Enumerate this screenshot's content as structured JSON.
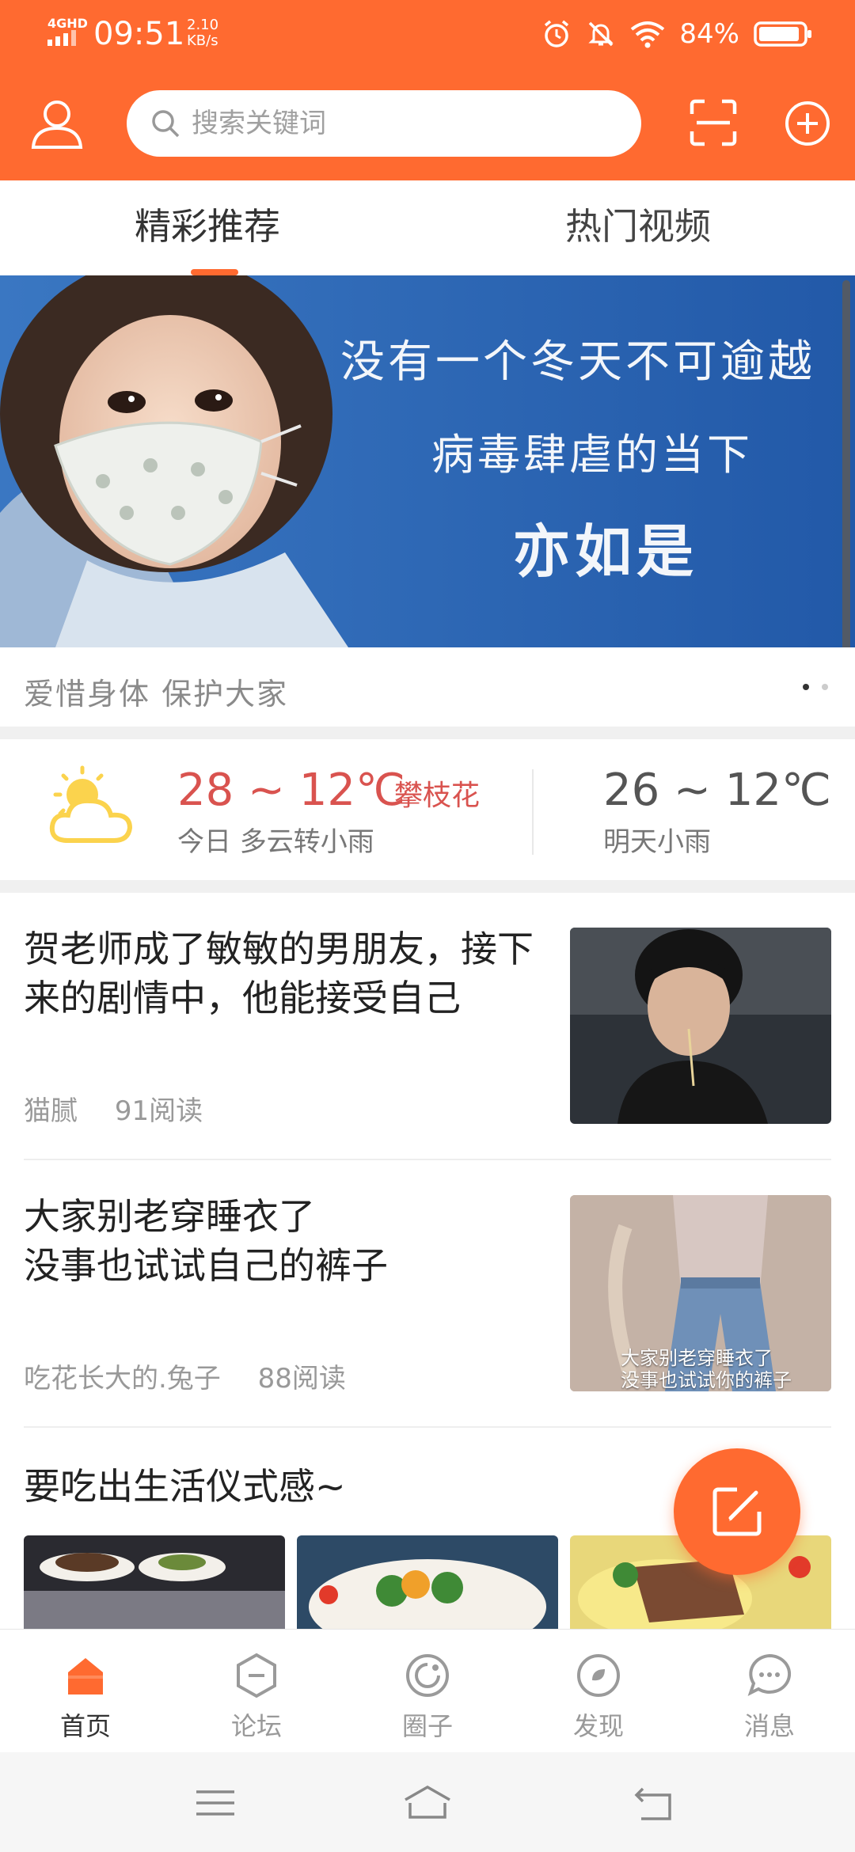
{
  "status_bar": {
    "network": "4GHD",
    "time": "09:51",
    "speed_value": "2.10",
    "speed_unit": "KB/s",
    "battery": "84%"
  },
  "header": {
    "search_placeholder": "搜索关键词",
    "user_icon": "user-icon",
    "scan_icon": "scan-icon",
    "add_icon": "add-circle-icon"
  },
  "tabs": [
    {
      "label": "精彩推荐",
      "active": true
    },
    {
      "label": "热门视频",
      "active": false
    }
  ],
  "banner": {
    "lines": [
      "没有一个冬天不可逾越",
      "病毒肆虐的当下",
      "亦如是"
    ],
    "caption": "爱惜身体  保护大家",
    "dots_total": 2,
    "dots_active_index": 0
  },
  "weather": {
    "today_temp": "28 ~ 12℃",
    "city": "攀枝花",
    "today_desc": "今日 多云转小雨",
    "tomorrow_temp": "26 ~ 12℃",
    "tomorrow_desc": "明天小雨",
    "icon": "partly-cloudy-icon"
  },
  "articles": [
    {
      "title": "贺老师成了敏敏的男朋友，接下来的剧情中，他能接受自己",
      "author": "猫腻",
      "reads": "91阅读"
    },
    {
      "title_line1": "大家别老穿睡衣了",
      "title_line2": "没事也试试自己的裤子",
      "author": "吃花长大的.兔子",
      "reads": "88阅读",
      "image_caption_line1": "大家别老穿睡衣了",
      "image_caption_line2": "没事也试试你的裤子"
    },
    {
      "title": "要吃出生活仪式感~"
    }
  ],
  "bottom_nav": [
    {
      "label": "首页",
      "icon": "home-icon",
      "active": true
    },
    {
      "label": "论坛",
      "icon": "forum-icon",
      "active": false
    },
    {
      "label": "圈子",
      "icon": "circle-icon",
      "active": false
    },
    {
      "label": "发现",
      "icon": "discover-icon",
      "active": false
    },
    {
      "label": "消息",
      "icon": "message-icon",
      "active": false
    }
  ],
  "colors": {
    "brand": "#ff6a30",
    "today_temp": "#d9534f"
  }
}
